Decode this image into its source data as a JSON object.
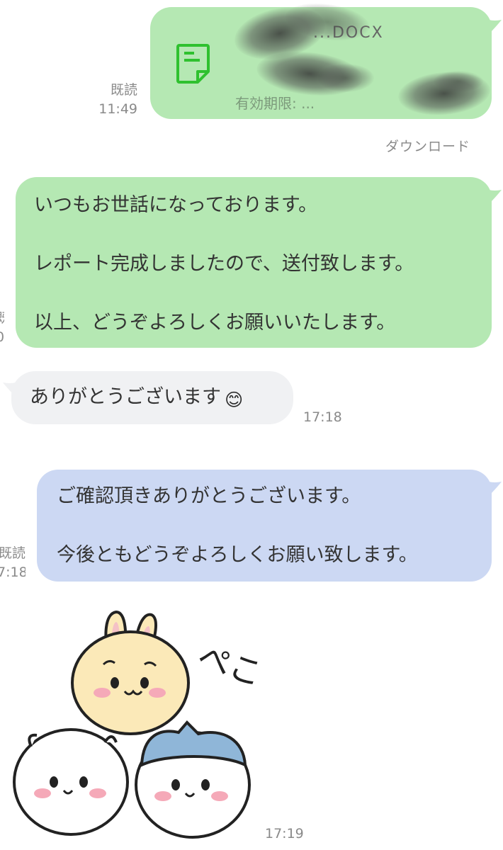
{
  "file_message": {
    "read_label": "既読",
    "time": "11:49",
    "filename": "...DOCX",
    "expiry": "有効期限: ...",
    "download_label": "ダウンロード"
  },
  "report_message": {
    "read_label": "既",
    "time": "0",
    "line1": "いつもお世話になっております。",
    "line2": "レポート完成しましたので、送付致します。",
    "line3": "以上、どうぞよろしくお願いいたします。"
  },
  "reply_message": {
    "text": "ありがとうございます",
    "emoji": "😊",
    "time": "17:18"
  },
  "confirm_message": {
    "read_label": "既読",
    "time": "7:18",
    "line1": "ご確認頂きありがとうございます。",
    "line2": "今後ともどうぞよろしくお願い致します。"
  },
  "sticker": {
    "text": "ぺこ",
    "time": "17:19"
  },
  "colors": {
    "sent_green": "#b5e8b3",
    "received_gray": "#f0f1f3",
    "selected_blue": "#ccd8f3",
    "file_icon_green": "#2fc12f"
  }
}
